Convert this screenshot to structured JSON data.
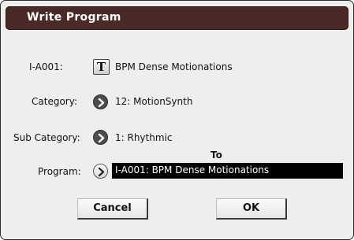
{
  "dialog": {
    "title": "Write Program"
  },
  "source": {
    "label": "I-A001:",
    "text_edit_button": "T",
    "name": "BPM Dense Motionations"
  },
  "category": {
    "label": "Category:",
    "value": "12: MotionSynth"
  },
  "sub_category": {
    "label": "Sub Category:",
    "value": "1: Rhythmic"
  },
  "destination": {
    "to_label": "To",
    "label": "Program:",
    "value": "I-A001: BPM Dense Motionations"
  },
  "buttons": {
    "cancel": "Cancel",
    "ok": "OK"
  },
  "colors": {
    "titlebar": "#4a2a26",
    "dialog_bg": "#efeeec",
    "field_bg": "#000000"
  },
  "icons": {
    "text_edit": "text-edit-icon",
    "category_popup": "popup-arrow-icon",
    "sub_category_popup": "popup-arrow-icon",
    "program_popup": "popup-arrow-icon"
  }
}
